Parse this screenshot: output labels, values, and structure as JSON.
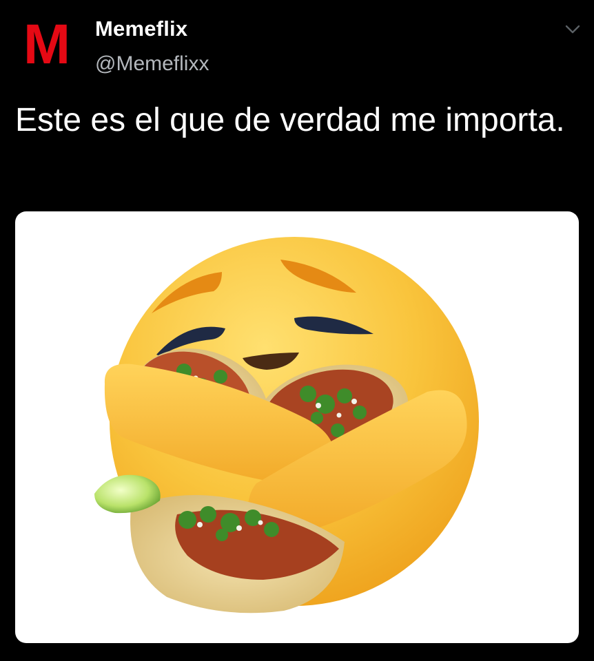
{
  "author": {
    "avatar_letter": "M",
    "name": "Memeflix",
    "handle": "@Memeflixx"
  },
  "tweet": {
    "text": "Este es el que de verdad me importa."
  },
  "icons": {
    "more": "chevron-down-icon",
    "avatar": "netflix-style-m-logo"
  },
  "colors": {
    "background": "#000000",
    "brand_red": "#e50914",
    "handle_gray": "#b4b8bd",
    "emoji_yellow": "#f8c43c",
    "media_background": "#ffffff"
  },
  "media": {
    "subject": "care-reaction-emoji-hugging-tacos",
    "background": "#ffffff"
  }
}
